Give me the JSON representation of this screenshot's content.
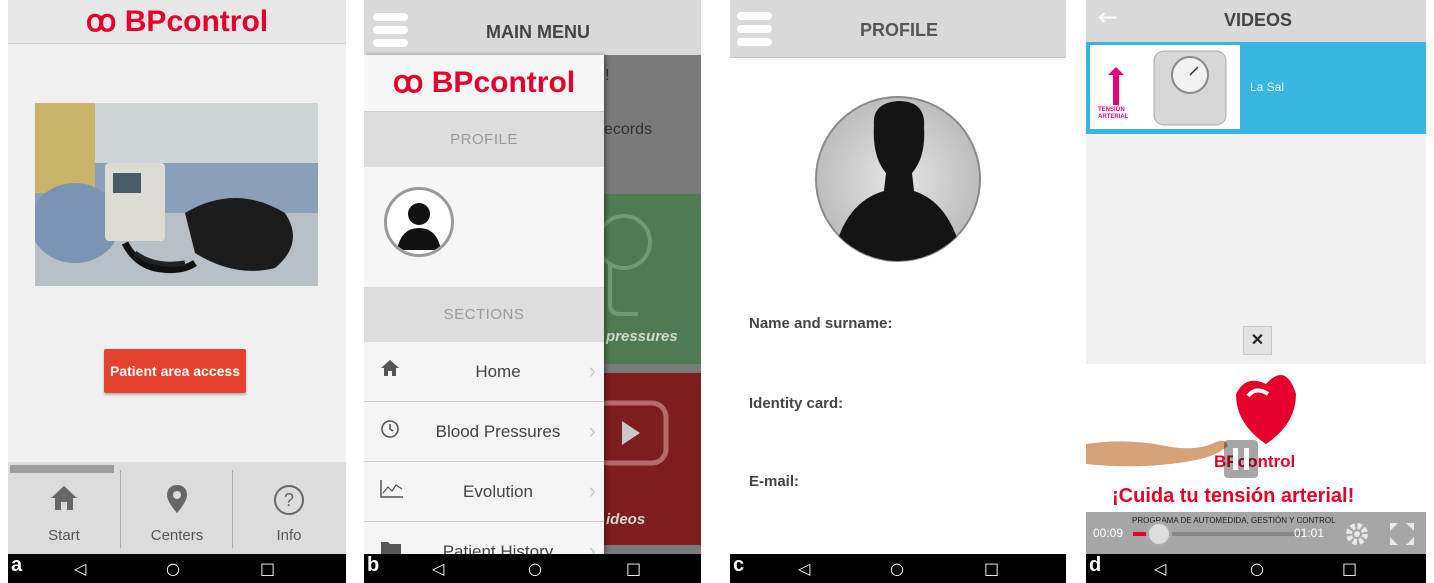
{
  "brand": {
    "bp": "BP",
    "control": "control",
    "heart": "ꝏ"
  },
  "colors": {
    "brand_red": "#e4002b",
    "access_button": "#e5432f",
    "video_row": "#38b5e0"
  },
  "panel_a": {
    "tag": "a",
    "access_button": "Patient area access",
    "tabs": [
      {
        "label": "Start",
        "icon": "home-icon"
      },
      {
        "label": "Centers",
        "icon": "location-pin-icon"
      },
      {
        "label": "Info",
        "icon": "question-icon"
      }
    ]
  },
  "panel_b": {
    "tag": "b",
    "title": "MAIN MENU",
    "profile_header": "PROFILE",
    "sections_header": "SECTIONS",
    "background_text_top": "!",
    "background_text": "ecords",
    "tile_green_text": "pressures",
    "tile_red_text": "ideos",
    "menu": [
      {
        "label": "Home",
        "icon": "home-icon"
      },
      {
        "label": "Blood Pressures",
        "icon": "clock-icon"
      },
      {
        "label": "Evolution",
        "icon": "chart-icon"
      },
      {
        "label": "Patient History",
        "icon": "folder-icon"
      }
    ]
  },
  "panel_c": {
    "tag": "c",
    "title": "PROFILE",
    "fields": [
      "Name and surname:",
      "Identity card:",
      "E-mail:"
    ]
  },
  "panel_d": {
    "tag": "d",
    "title": "VIDEOS",
    "video_title": "La Sal",
    "thumb_label_1": "TENSIÓN",
    "thumb_label_2": "ARTERIAL",
    "close_label": "✕",
    "video_logo": "BPcontrol",
    "slogan": "¡Cuida tu tensión arterial!",
    "subslogan": "PROGRAMA DE AUTOMEDIDA, GESTIÓN Y CONTROL",
    "time_elapsed": "00:09",
    "time_total": "01:01",
    "progress": 0.15
  },
  "system_nav": {
    "back": "◁",
    "home": "○",
    "recents": "□"
  }
}
